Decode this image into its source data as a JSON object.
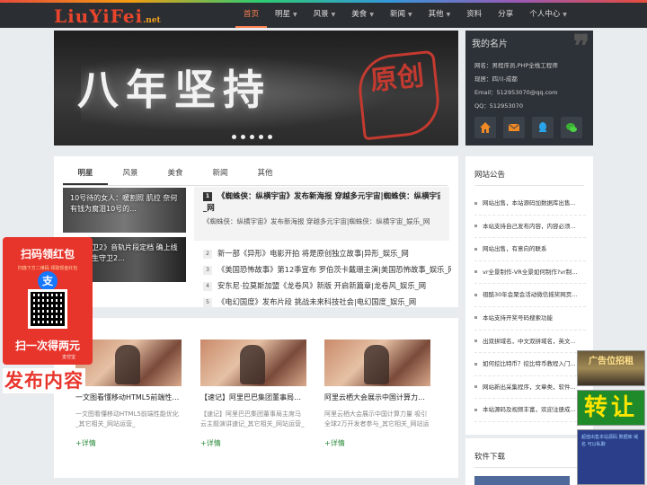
{
  "site": {
    "logo_main": "LiuYiFei",
    "logo_suffix": ".net"
  },
  "nav": {
    "items": [
      {
        "label": "首页",
        "caret": false,
        "active": true
      },
      {
        "label": "明星",
        "caret": true
      },
      {
        "label": "风景",
        "caret": true
      },
      {
        "label": "美食",
        "caret": true
      },
      {
        "label": "新闻",
        "caret": true
      },
      {
        "label": "其他",
        "caret": true
      },
      {
        "label": "资料",
        "caret": false
      },
      {
        "label": "分享",
        "caret": false
      },
      {
        "label": "个人中心",
        "caret": true
      }
    ],
    "caret_glyph": "▼"
  },
  "banner": {
    "text": "八年坚持",
    "seal": "原创",
    "slide_count": 5
  },
  "profile": {
    "title": "我的名片",
    "name": "网名：男程序员,PHP全栈工程师",
    "location": "现居：四川-成都",
    "email": "Email：512953070@qq.com",
    "qq": "QQ：512953070",
    "icons": [
      "home-icon",
      "email-icon",
      "qq-icon",
      "wechat-icon"
    ]
  },
  "tabs": [
    "明星",
    "风景",
    "美食",
    "新闻",
    "其他"
  ],
  "thumbs": [
    "10号待的女人：暖割照 肌拉 奈何有钱为腐泪10号的...",
    "《生守卫2》音轨片段定档 确上线阿瓦夫生守卫2..."
  ],
  "featured": {
    "num": "1",
    "title": "《蜘蛛侠：纵横宇宙》发布新海报 穿越多元宇宙|蜘蛛侠：纵横宇宙_娱乐",
    "title_tail": "_网",
    "desc": "《蜘蛛侠：纵横宇宙》发布新海报 穿越多元宇宙|蜘蛛侠：纵横宇宙_娱乐_网"
  },
  "news": [
    {
      "num": "2",
      "text": "新一部《异形》电影开拍 将是原创独立故事|异形_娱乐_网"
    },
    {
      "num": "3",
      "text": "《美国恐怖故事》第12季宣布 罗伯茨卡戴珊主演|美国恐怖故事_娱乐_网"
    },
    {
      "num": "4",
      "text": "安东尼·拉莫斯加盟《龙卷风》新版 开启新篇章|龙卷风_娱乐_网"
    },
    {
      "num": "5",
      "text": "《电幻国度》发布片段 挑战未来科技社会|电幻国度_娱乐_网"
    }
  ],
  "posts": [
    {
      "title": "一文图看懂移动HTML5前端性能...",
      "desc": "一文图看懂移动HTML5前端性能优化_其它相关_网站运营_",
      "more": "+详情"
    },
    {
      "title": "【速记】阿里巴巴集团董事局主...",
      "desc": "【速记】阿里巴巴集团董事局主席马云主题演讲速记_其它相关_网站运营_",
      "more": "+详情"
    },
    {
      "title": "阿里云栖大会展示中国计算力量 ...",
      "desc": "阿里云栖大会展示中国计算力量 吸引全球2万开发者参与_其它相关_网站运营_",
      "more": "+详情"
    }
  ],
  "notice": {
    "title": "网站公告",
    "items": [
      "网站出售，本站源码加数据库出售...",
      "本站支持自己发布内容，内容必须...",
      "网站出售，有意向的联系",
      "vr全景制作-VR全景如何制作?vr制...",
      "祖酷30年会聚会活动微信摇奖网页...",
      "本站支持开奖号码搜索功能",
      "出双拼域名，中文双拼域名，英文...",
      "如何挖比特币？挖比特币教程入门...",
      "网站新出采集程序，文章类，软件...",
      "本站源码及视频丰富，欢迎注册成..."
    ]
  },
  "software": {
    "title": "软件下载"
  },
  "redpack": {
    "title": "扫码领红包",
    "subtitle": "扫描下方二维码 领取现金红包",
    "ali": "支",
    "claim": "扫一次得两元",
    "brand": "支付宝"
  },
  "publish": "发布内容",
  "ads": {
    "ad1": "广告位招租",
    "ad2": "转让",
    "ad3": "超值出售本站源码 数据库 域名 可以私聊"
  }
}
